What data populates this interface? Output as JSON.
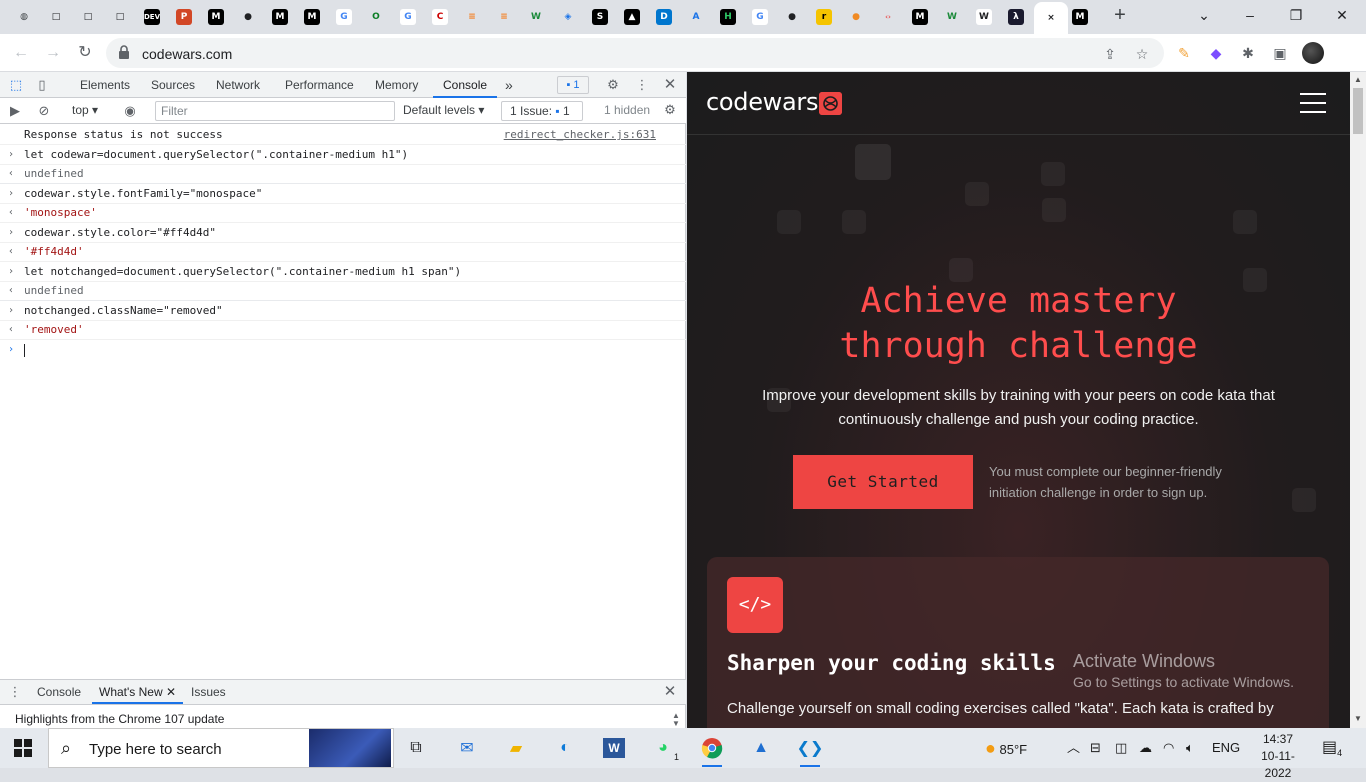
{
  "browser": {
    "tab_favicons": [
      {
        "name": "browser-globe-icon",
        "char": "◍",
        "bg": "#dee1e6",
        "fg": "#3c4043"
      },
      {
        "name": "tab-blank-icon",
        "char": "□",
        "bg": "#dee1e6",
        "fg": "#202124"
      },
      {
        "name": "tab-blank-icon",
        "char": "□",
        "bg": "#dee1e6",
        "fg": "#202124"
      },
      {
        "name": "tab-blank-icon",
        "char": "□",
        "bg": "#dee1e6",
        "fg": "#202124"
      },
      {
        "name": "dev-icon",
        "char": "DEV",
        "bg": "#000000",
        "fg": "#ffffff"
      },
      {
        "name": "powerpoint-icon",
        "char": "P",
        "bg": "#d24726",
        "fg": "#ffffff"
      },
      {
        "name": "medium-icon",
        "char": "M",
        "bg": "#000000",
        "fg": "#ffffff"
      },
      {
        "name": "github-icon",
        "char": "●",
        "bg": "#dee1e6",
        "fg": "#202124"
      },
      {
        "name": "medium-icon",
        "char": "M",
        "bg": "#000000",
        "fg": "#ffffff"
      },
      {
        "name": "medium-icon",
        "char": "M",
        "bg": "#000000",
        "fg": "#ffffff"
      },
      {
        "name": "google-icon",
        "char": "G",
        "bg": "#ffffff",
        "fg": "#4285f4"
      },
      {
        "name": "opera-icon",
        "char": "O",
        "bg": "#dee1e6",
        "fg": "#0a7d24"
      },
      {
        "name": "google-icon",
        "char": "G",
        "bg": "#ffffff",
        "fg": "#4285f4"
      },
      {
        "name": "canon-icon",
        "char": "C",
        "bg": "#ffffff",
        "fg": "#cc0000"
      },
      {
        "name": "stackoverflow-icon",
        "char": "≡",
        "bg": "#dee1e6",
        "fg": "#f48024"
      },
      {
        "name": "stackoverflow-icon",
        "char": "≡",
        "bg": "#dee1e6",
        "fg": "#f48024"
      },
      {
        "name": "w-icon",
        "char": "W",
        "bg": "#dee1e6",
        "fg": "#1b8a3a"
      },
      {
        "name": "shield-icon",
        "char": "◈",
        "bg": "#dee1e6",
        "fg": "#1a73e8"
      },
      {
        "name": "s-icon",
        "char": "S",
        "bg": "#000000",
        "fg": "#ffffff"
      },
      {
        "name": "triangle-icon",
        "char": "▲",
        "bg": "#000000",
        "fg": "#ffffff"
      },
      {
        "name": "dell-icon",
        "char": "D",
        "bg": "#0076ce",
        "fg": "#ffffff"
      },
      {
        "name": "a-icon",
        "char": "A",
        "bg": "#dee1e6",
        "fg": "#1a73e8"
      },
      {
        "name": "hackerrank-icon",
        "char": "H",
        "bg": "#000000",
        "fg": "#2ec866"
      },
      {
        "name": "google-icon",
        "char": "G",
        "bg": "#ffffff",
        "fg": "#4285f4"
      },
      {
        "name": "github-icon",
        "char": "●",
        "bg": "#dee1e6",
        "fg": "#202124"
      },
      {
        "name": "realme-icon",
        "char": "r",
        "bg": "#f5c400",
        "fg": "#000000"
      },
      {
        "name": "orange-circle-icon",
        "char": "●",
        "bg": "#dee1e6",
        "fg": "#f08a24"
      },
      {
        "name": "code-icon",
        "char": "‹›",
        "bg": "#dee1e6",
        "fg": "#e94f4f"
      },
      {
        "name": "medium-icon",
        "char": "M",
        "bg": "#000000",
        "fg": "#ffffff"
      },
      {
        "name": "w-icon",
        "char": "W",
        "bg": "#dee1e6",
        "fg": "#1b8a3a"
      },
      {
        "name": "wikipedia-icon",
        "char": "W",
        "bg": "#ffffff",
        "fg": "#202124"
      },
      {
        "name": "lambda-icon",
        "char": "λ",
        "bg": "#1a1a2e",
        "fg": "#ffffff"
      },
      {
        "name": "codewars-icon",
        "char": "×",
        "bg": "#ffffff",
        "fg": "#202124"
      },
      {
        "name": "medium-icon",
        "char": "M",
        "bg": "#000000",
        "fg": "#ffffff"
      }
    ],
    "url": "codewars.com",
    "new_tab_label": "+",
    "window_controls": [
      "⌄",
      "–",
      "❐",
      "✕"
    ]
  },
  "devtools": {
    "tabs": [
      "Elements",
      "Sources",
      "Network",
      "Performance",
      "Memory",
      "Console"
    ],
    "active_tab": "Console",
    "more_tabs_label": "»",
    "issues_count_badge": "1",
    "context": "top",
    "filter_placeholder": "Filter",
    "levels": "Default levels ▾",
    "issue_label": "1 Issue: ",
    "issue_count": "1",
    "hidden_label": "1 hidden",
    "console_lines": [
      {
        "type": "log",
        "text": "Response status is not success",
        "source": "redirect_checker.js:631"
      },
      {
        "type": "input",
        "text": "let codewar=document.querySelector(\".container-medium h1\")"
      },
      {
        "type": "result",
        "text": "undefined"
      },
      {
        "type": "input",
        "text": "codewar.style.fontFamily=\"monospace\""
      },
      {
        "type": "string",
        "text": "'monospace'"
      },
      {
        "type": "input",
        "text": "codewar.style.color=\"#ff4d4d\""
      },
      {
        "type": "string",
        "text": "'#ff4d4d'"
      },
      {
        "type": "input",
        "text": "let notchanged=document.querySelector(\".container-medium h1 span\")"
      },
      {
        "type": "result",
        "text": "undefined"
      },
      {
        "type": "input",
        "text": "notchanged.className=\"removed\""
      },
      {
        "type": "string",
        "text": "'removed'"
      }
    ],
    "drawer_tabs": [
      "Console",
      "What's New",
      "Issues"
    ],
    "drawer_active": "What's New",
    "whats_new_text": "Highlights from the Chrome 107 update"
  },
  "page": {
    "logo_text": "codewars",
    "hero_line1": "Achieve mastery",
    "hero_line2": "through challenge",
    "hero_sub": "Improve your development skills by training with your peers on code kata that continuously challenge and push your coding practice.",
    "cta_label": "Get Started",
    "cta_note": "You must complete our beginner-friendly initiation challenge in order to sign up.",
    "card_icon": "</>",
    "card_title": "Sharpen your coding skills",
    "card_text": "Challenge yourself on small coding exercises called \"kata\". Each kata is crafted by",
    "accent_color": "#ff4d4d",
    "button_color": "#ee4543"
  },
  "activation": {
    "line1": "Activate Windows",
    "line2": "Go to Settings to activate Windows."
  },
  "taskbar": {
    "search_placeholder": "Type here to search",
    "weather": "85°F",
    "language": "ENG",
    "time": "14:37",
    "date": "10-11-2022",
    "notifications": "4",
    "whatsapp_badge": "1"
  }
}
